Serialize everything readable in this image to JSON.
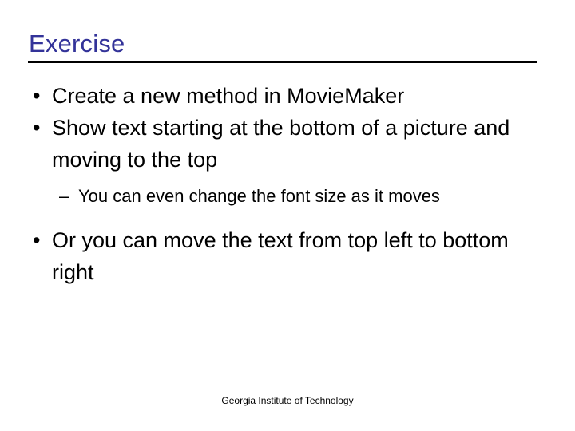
{
  "slide": {
    "title": "Exercise",
    "title_color": "#333399",
    "rule_color": "#000000",
    "background_color": "#ffffff",
    "text_color": "#000000",
    "bullet_marker": "•",
    "sub_bullet_marker": "–",
    "content": [
      {
        "level": 1,
        "marker": "•",
        "text": "Create a new method in MovieMaker"
      },
      {
        "level": 1,
        "marker": "•",
        "text": "Show text starting at the bottom of a picture and moving to the top"
      },
      {
        "level": 2,
        "marker": "–",
        "text": "You can even change the font size as it moves"
      },
      {
        "level": 1,
        "marker": "•",
        "text": "Or you can move the text from top left to bottom right"
      }
    ]
  },
  "footer": {
    "text": "Georgia Institute of Technology"
  }
}
